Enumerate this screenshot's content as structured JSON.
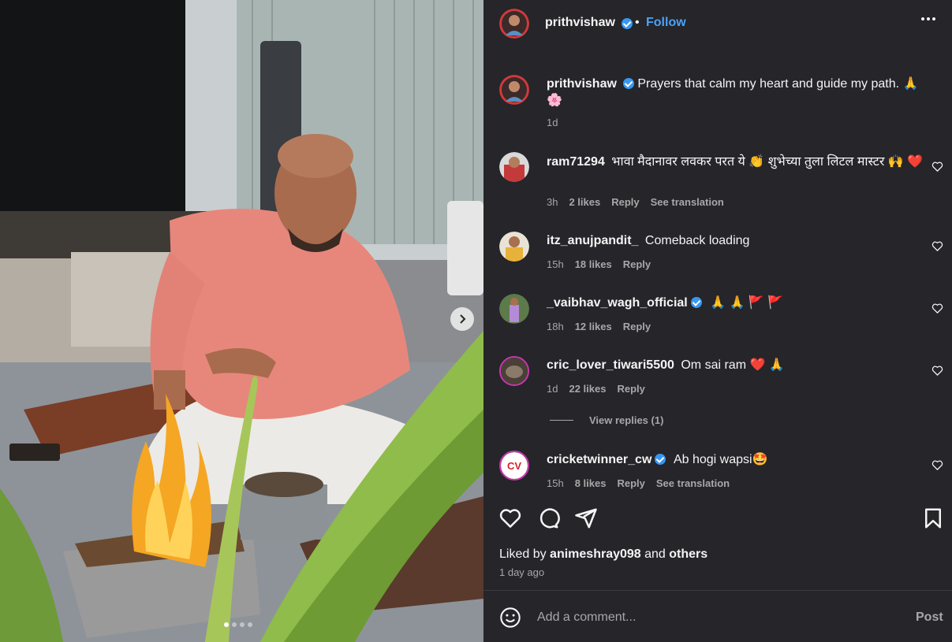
{
  "post": {
    "username": "prithvishaw",
    "separator": "•",
    "follow_label": "Follow",
    "caption": "Prayers that calm my heart and guide my path. 🙏🌸",
    "caption_time": "1d"
  },
  "comments": [
    {
      "username": "ram71294",
      "text": "भावा मैदानावर लवकर परत ये 👏 शुभेच्या तुला लिटल मास्टर 🙌 ❤️",
      "time": "3h",
      "likes": "2 likes",
      "reply": "Reply",
      "translate": "See translation",
      "verified": false
    },
    {
      "username": "itz_anujpandit_",
      "text": "Comeback loading",
      "time": "15h",
      "likes": "18 likes",
      "reply": "Reply",
      "verified": false
    },
    {
      "username": "_vaibhav_wagh_official",
      "text": "🙏 🙏 🚩 🚩",
      "time": "18h",
      "likes": "12 likes",
      "reply": "Reply",
      "verified": true
    },
    {
      "username": "cric_lover_tiwari5500",
      "text": "Om sai ram ❤️ 🙏",
      "time": "1d",
      "likes": "22 likes",
      "reply": "Reply",
      "verified": false,
      "view_replies": "View replies (1)"
    },
    {
      "username": "cricketwinner_cw",
      "text": "Ab hogi wapsi🤩",
      "time": "15h",
      "likes": "8 likes",
      "reply": "Reply",
      "translate": "See translation",
      "verified": true
    }
  ],
  "likes": {
    "prefix": "Liked by ",
    "user": "animeshray098",
    "middle": " and ",
    "others": "others"
  },
  "posted_time": "1 day ago",
  "composer": {
    "placeholder": "Add a comment...",
    "post_label": "Post"
  },
  "carousel": {
    "slide_count": 4,
    "active_index": 0
  },
  "colors": {
    "panel_bg": "#25252a",
    "link_blue": "#4aa3f5",
    "verified_blue": "#3897f0",
    "muted": "#a8a8a8"
  }
}
